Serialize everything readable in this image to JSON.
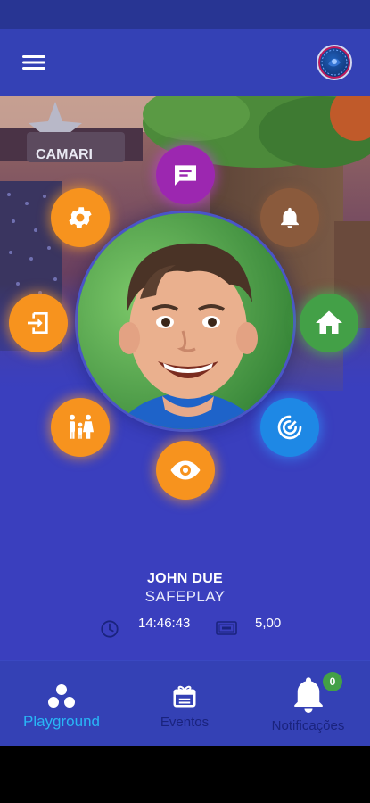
{
  "colors": {
    "primary": "#3441b5",
    "status_bar": "#283593",
    "accent_orange": "#f7931e",
    "accent_purple": "#9c27b0",
    "accent_green": "#43a047",
    "accent_blue": "#1e88e5",
    "accent_brown": "#8a5a3c",
    "active_tab": "#29b6f6",
    "inactive_tab": "#1a237e"
  },
  "appbar": {
    "menu_icon": "hamburger-menu-icon",
    "logo_icon": "safeplay-logo-icon"
  },
  "background": {
    "sign_text": "CAMARI"
  },
  "actions": [
    {
      "id": "chat",
      "icon": "chat-bubble-icon",
      "color": "purple"
    },
    {
      "id": "settings",
      "icon": "gear-icon",
      "color": "orange"
    },
    {
      "id": "notifications",
      "icon": "bell-icon",
      "color": "brown"
    },
    {
      "id": "exit",
      "icon": "exit-door-icon",
      "color": "orange"
    },
    {
      "id": "home",
      "icon": "home-icon",
      "color": "green"
    },
    {
      "id": "family",
      "icon": "family-icon",
      "color": "orange"
    },
    {
      "id": "tracking",
      "icon": "radar-signal-icon",
      "color": "blue"
    },
    {
      "id": "view",
      "icon": "eye-icon",
      "color": "orange"
    }
  ],
  "child": {
    "name": "JOHN DUE",
    "venue": "SAFEPLAY",
    "time": "14:46:43",
    "amount": "5,00",
    "time_icon": "clock-icon",
    "amount_icon": "ticket-icon"
  },
  "tabs": {
    "playground": {
      "label": "Playground",
      "icon": "playground-dots-icon",
      "active": true
    },
    "events": {
      "label": "Eventos",
      "icon": "gift-calendar-icon",
      "active": false
    },
    "notifications": {
      "label": "Notificações",
      "icon": "bell-icon",
      "badge": "0",
      "active": false
    }
  }
}
